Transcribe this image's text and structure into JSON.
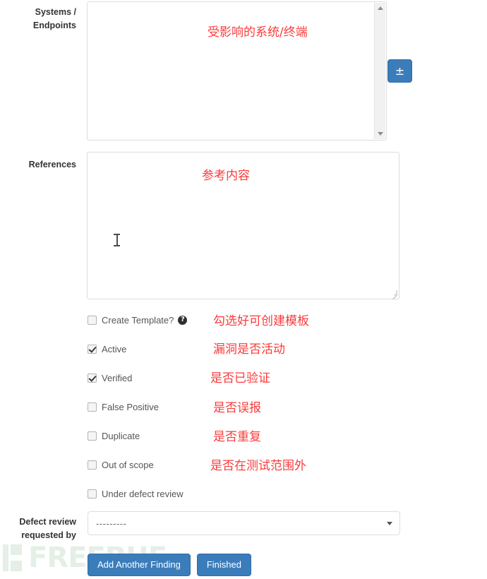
{
  "form": {
    "systems": {
      "label": "Systems / Endpoints",
      "label_line1": "Systems /",
      "label_line2": "Endpoints",
      "annotation_cn": "受影响的系统/终端",
      "value": "",
      "placeholder": ""
    },
    "references": {
      "label": "References",
      "annotation_cn": "参考内容",
      "value": "",
      "placeholder": ""
    },
    "plus_minus_button": {
      "label": "±"
    },
    "checkboxes": [
      {
        "name": "create-template",
        "label": "Create Template?",
        "checked": false,
        "has_help": true,
        "help_glyph": "?",
        "annotation_cn": "勾选好可创建模板"
      },
      {
        "name": "active",
        "label": "Active",
        "checked": true,
        "has_help": false,
        "annotation_cn": "漏洞是否活动"
      },
      {
        "name": "verified",
        "label": "Verified",
        "checked": true,
        "has_help": false,
        "annotation_cn": "是否已验证"
      },
      {
        "name": "false-positive",
        "label": "False Positive",
        "checked": false,
        "has_help": false,
        "annotation_cn": "是否误报"
      },
      {
        "name": "duplicate",
        "label": "Duplicate",
        "checked": false,
        "has_help": false,
        "annotation_cn": "是否重复"
      },
      {
        "name": "out-of-scope",
        "label": "Out of scope",
        "checked": false,
        "has_help": false,
        "annotation_cn": "是否在测试范围外"
      },
      {
        "name": "under-defect-review",
        "label": "Under defect review",
        "checked": false,
        "has_help": false,
        "annotation_cn": ""
      }
    ],
    "defect_review": {
      "label": "Defect review requested by",
      "label_line1": "Defect review",
      "label_line2": "requested by",
      "selected_value": "---------"
    },
    "buttons": {
      "add_another": "Add Another Finding",
      "finished": "Finished"
    }
  },
  "watermark": {
    "text": "FREEBUF"
  },
  "colors": {
    "annotation_red": "#fb3b3b",
    "button_blue": "#3b7dbb",
    "button_border": "#2e6da4",
    "label_text": "#333333",
    "field_border": "#dddddd",
    "watermark": "#e4efe6"
  }
}
